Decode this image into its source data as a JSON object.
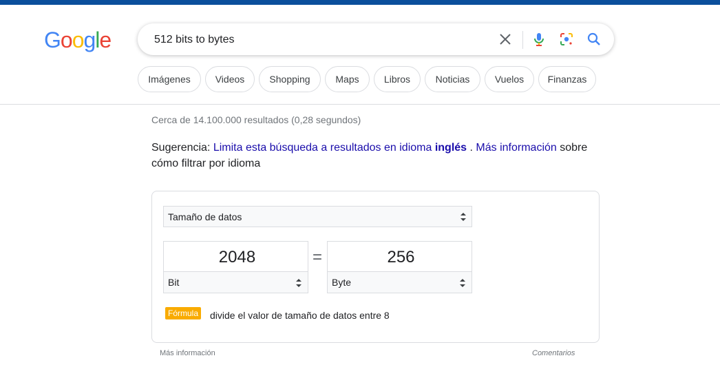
{
  "logo": {
    "letters": [
      "G",
      "o",
      "o",
      "g",
      "l",
      "e"
    ],
    "colors": [
      "#4285F4",
      "#EA4335",
      "#FBBC05",
      "#4285F4",
      "#34A853",
      "#EA4335"
    ]
  },
  "search": {
    "query": "512 bits to bytes"
  },
  "chips": [
    "Imágenes",
    "Videos",
    "Shopping",
    "Maps",
    "Libros",
    "Noticias",
    "Vuelos",
    "Finanzas"
  ],
  "stats": "Cerca de 14.100.000 resultados (0,28 segundos)",
  "suggestion": {
    "prefix": "Sugerencia:",
    "link1": "Limita esta búsqueda a resultados en idioma",
    "lang": "inglés",
    "dot": ".",
    "link2": "Más información",
    "suffix": "sobre cómo filtrar por idioma"
  },
  "converter": {
    "category": "Tamaño de datos",
    "from_value": "2048",
    "from_unit": "Bit",
    "equals": "=",
    "to_value": "256",
    "to_unit": "Byte",
    "formula_label": "Fórmula",
    "formula_text": "divide el valor de tamaño de datos entre 8"
  },
  "footer": {
    "more": "Más información",
    "feedback": "Comentarios"
  },
  "colors": {
    "accent_bar": "#0b4f9c",
    "link": "#1a0dab",
    "formula_badge": "#f9ab00"
  }
}
